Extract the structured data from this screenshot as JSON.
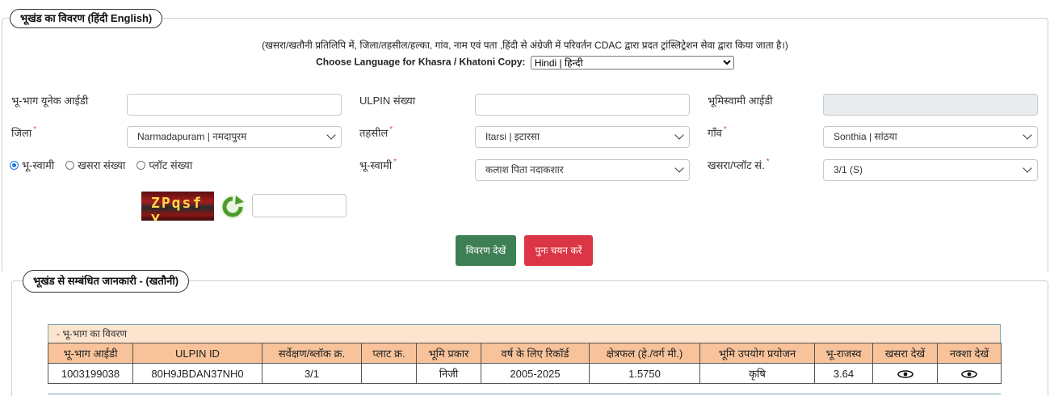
{
  "section1": {
    "legend": "भूखंड का विवरण  (हिंदी  English)",
    "note": "(खसरा/खतौनी प्रतिलिपि में, जिला/तहसील/हल्का, गांव, नाम एवं पता ,हिंदी से अंग्रेजी में परिवर्तन CDAC द्वारा प्रदत ट्रांस्लिट्रेशन सेवा द्वारा किया जाता है।)",
    "language_label": "Choose Language for Khasra / Khatoni Copy:",
    "language_value": "Hindi | हिन्दी",
    "fields": {
      "unique_id_label": "भू-भाग यूनेक आईडी",
      "ulpin_label": "ULPIN संख्या",
      "owner_id_label": "भूमिस्वामी आईडी",
      "district_label": "जिला",
      "district_value": "Narmadapuram | नमदापुरम",
      "tehsil_label": "तहसील",
      "tehsil_value": "Itarsi | इटारसा",
      "village_label": "गाँव",
      "village_value": "Sonthia | सांठया",
      "owner_label": "भू-स्वामी",
      "owner_value": "कलाश पिता नदाकशार",
      "khasra_label": "खसरा/प्लॉट सं.",
      "khasra_value": "3/1 (S)",
      "required_mark": "*"
    },
    "search_by": {
      "options": [
        "भू-स्वामी",
        "खसरा संख्या",
        "प्लॉट संख्या"
      ],
      "selected_index": 0
    },
    "captcha_text": "ZPqsf Y",
    "buttons": {
      "view": "विवरण देखें",
      "reset": "पुनः चयन करें"
    }
  },
  "section2": {
    "legend": "भूखंड से सम्बंधित जानकारी -  (खतौनी)",
    "table_caption": "- भू-भाग का विवरण",
    "columns": [
      "भू-भाग आईडी",
      "ULPIN ID",
      "सर्वेक्षण/ब्लॉक क्र.",
      "प्लाट क्र.",
      "भूमि प्रकार",
      "वर्ष के लिए रिकॉर्ड",
      "क्षेत्रफल (हे./वर्ग मी.)",
      "भूमि उपयोग प्रयोजन",
      "भू-राजस्व",
      "खसरा देखें",
      "नक्शा देखें"
    ],
    "rows": [
      [
        "1003199038",
        "80H9JBDAN37NH0",
        "3/1",
        "",
        "निजी",
        "2005-2025",
        "1.5750",
        "कृषि",
        "3.64",
        "eye-icon",
        "eye-icon"
      ]
    ]
  }
}
